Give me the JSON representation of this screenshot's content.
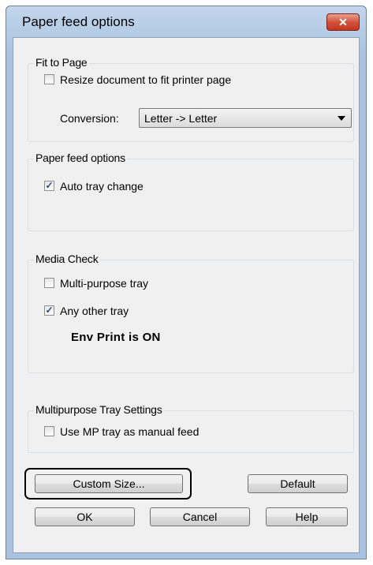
{
  "window": {
    "title": "Paper feed options"
  },
  "fit_to_page": {
    "label": "Fit to Page",
    "resize_label": "Resize document to fit printer page",
    "resize_checked": false,
    "conversion_label": "Conversion:",
    "conversion_value": "Letter -> Letter"
  },
  "paper_feed": {
    "label": "Paper feed options",
    "auto_tray_label": "Auto tray change",
    "auto_tray_checked": true
  },
  "media_check": {
    "label": "Media Check",
    "multi_purpose_label": "Multi-purpose tray",
    "multi_purpose_checked": false,
    "any_other_label": "Any other tray",
    "any_other_checked": true,
    "status_text": "Env Print is ON"
  },
  "mp_tray": {
    "label": "Multipurpose Tray Settings",
    "manual_feed_label": "Use MP tray as manual feed",
    "manual_feed_checked": false
  },
  "buttons": {
    "custom_size": "Custom Size...",
    "default": "Default",
    "ok": "OK",
    "cancel": "Cancel",
    "help": "Help"
  },
  "icons": {
    "close": "close-icon",
    "dropdown": "chevron-down-icon",
    "check": "checkmark-icon"
  }
}
